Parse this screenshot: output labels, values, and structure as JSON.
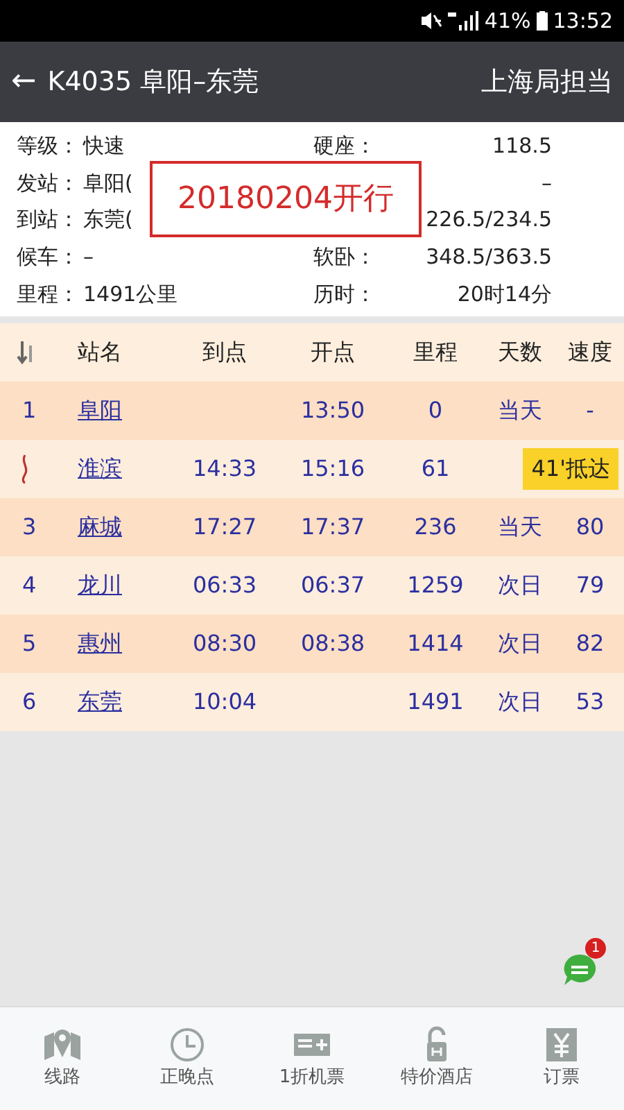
{
  "status_bar": {
    "battery": "41%",
    "time": "13:52"
  },
  "header": {
    "back": "←",
    "title": "K4035 阜阳–东莞",
    "bureau": "上海局担当"
  },
  "info": [
    {
      "left": {
        "label": "等级：",
        "value": "快速"
      },
      "right": {
        "label": "硬座：",
        "value": "118.5"
      }
    },
    {
      "left": {
        "label": "发站：",
        "value": "阜阳("
      },
      "right": {
        "value": "–"
      }
    },
    {
      "left": {
        "label": "到站：",
        "value": "东莞("
      },
      "right": {
        "value": "226.5/234.5"
      }
    },
    {
      "left": {
        "label": "候车：",
        "value": "–"
      },
      "right": {
        "label": "软卧：",
        "value": "348.5/363.5"
      }
    },
    {
      "left": {
        "label": "里程：",
        "value": "1491公里"
      },
      "right": {
        "label": "历时：",
        "value": "20时14分"
      }
    }
  ],
  "stamp": "20180204开行",
  "table": {
    "columns": [
      "站名",
      "到点",
      "开点",
      "里程",
      "天数",
      "速度"
    ],
    "rows": [
      {
        "kind": "stop",
        "index": "1",
        "station": "阜阳",
        "depart": "13:50",
        "km": "0",
        "day": "当天",
        "speed": "-"
      },
      {
        "kind": "current",
        "station": "淮滨",
        "arrive": "14:33",
        "depart": "15:16",
        "km": "61",
        "note": "41'抵达"
      },
      {
        "kind": "stop",
        "index": "3",
        "station": "麻城",
        "arrive": "17:27",
        "depart": "17:37",
        "km": "236",
        "day": "当天",
        "speed": "80"
      },
      {
        "kind": "stop",
        "index": "4",
        "station": "龙川",
        "arrive": "06:33",
        "depart": "06:37",
        "km": "1259",
        "day": "次日",
        "speed": "79"
      },
      {
        "kind": "stop",
        "index": "5",
        "station": "惠州",
        "arrive": "08:30",
        "depart": "08:38",
        "km": "1414",
        "day": "次日",
        "speed": "82"
      },
      {
        "kind": "stop",
        "index": "6",
        "station": "东莞",
        "arrive": "10:04",
        "km": "1491",
        "day": "次日",
        "speed": "53"
      }
    ]
  },
  "chat_badge": "1",
  "nav": [
    {
      "kind": "route",
      "label": "线路"
    },
    {
      "kind": "clock",
      "label": "正晚点"
    },
    {
      "kind": "flight",
      "label": "1折机票"
    },
    {
      "kind": "hotel",
      "label": "特价酒店"
    },
    {
      "kind": "ticket",
      "label": "订票"
    }
  ]
}
